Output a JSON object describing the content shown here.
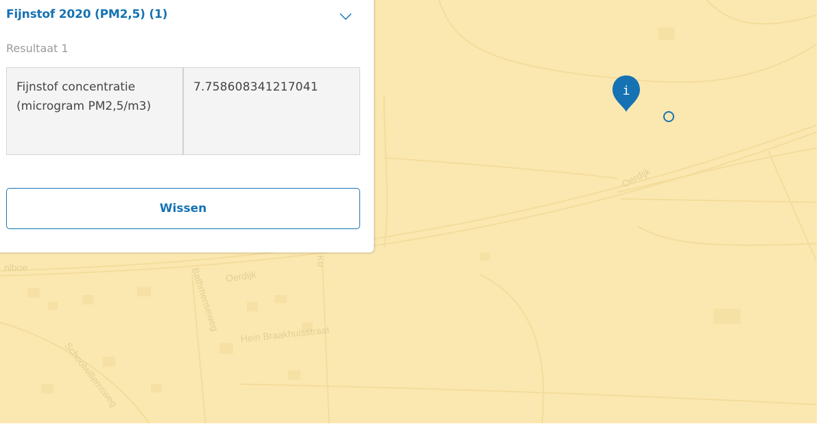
{
  "panel": {
    "title": "Fijnstof 2020 (PM2,5) (1)",
    "result_label": "Resultaat 1",
    "attributes": [
      {
        "key": "Fijnstof concentratie (microgram PM2,5/m3)",
        "value": "7.758608341217041"
      }
    ],
    "clear_label": "Wissen"
  },
  "map": {
    "street_labels": [
      "Oerdijk",
      "Oerdijk",
      "Bathmenseweg",
      "Hein Braakhuisstraat",
      "Schoolwillemsweg",
      "Ko",
      "nlboe"
    ],
    "marker_glyph": "i",
    "marker_icon": "info-pin-icon",
    "colors": {
      "accent": "#1672b3",
      "map_background": "#fbe8b0",
      "street_label": "#e2cf96"
    }
  }
}
